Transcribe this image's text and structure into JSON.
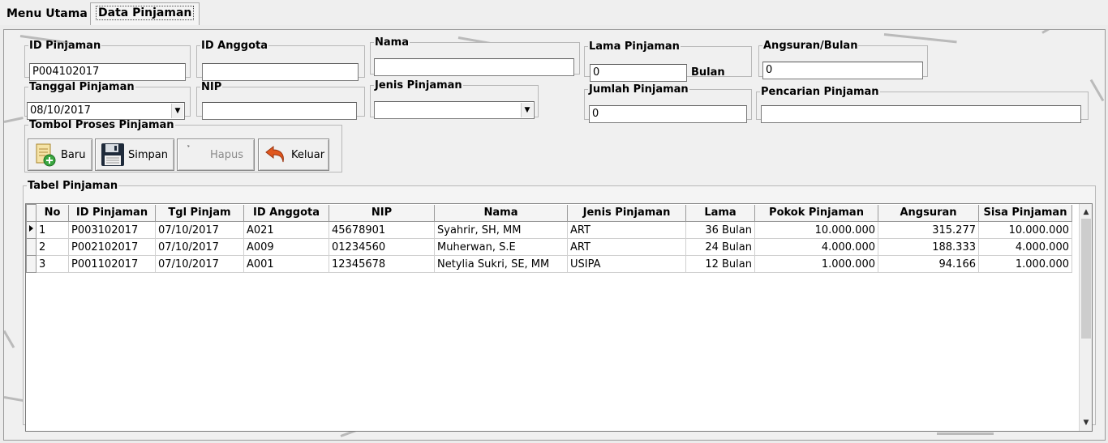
{
  "tabs": [
    {
      "label": "Menu Utama"
    },
    {
      "label": "Data Pinjaman"
    }
  ],
  "form": {
    "id_pinjaman": {
      "label": "ID Pinjaman",
      "value": "P004102017"
    },
    "id_anggota": {
      "label": "ID Anggota",
      "value": ""
    },
    "nama": {
      "label": "Nama",
      "value": ""
    },
    "lama_pinjaman": {
      "label": "Lama Pinjaman",
      "value": "0",
      "unit": "Bulan"
    },
    "angsuran_bulan": {
      "label": "Angsuran/Bulan",
      "value": "0"
    },
    "tanggal_pinjaman": {
      "label": "Tanggal Pinjaman",
      "value": "08/10/2017"
    },
    "nip": {
      "label": "NIP",
      "value": ""
    },
    "jenis_pinjaman": {
      "label": "Jenis Pinjaman",
      "value": ""
    },
    "jumlah_pinjaman": {
      "label": "Jumlah Pinjaman",
      "value": "0"
    },
    "pencarian_pinjaman": {
      "label": "Pencarian Pinjaman",
      "value": ""
    }
  },
  "buttons": {
    "group_label": "Tombol Proses Pinjaman",
    "baru": "Baru",
    "simpan": "Simpan",
    "hapus": "Hapus",
    "keluar": "Keluar"
  },
  "table": {
    "label": "Tabel Pinjaman",
    "columns": [
      "No",
      "ID Pinjaman",
      "Tgl Pinjam",
      "ID Anggota",
      "NIP",
      "Nama",
      "Jenis Pinjaman",
      "Lama",
      "Pokok Pinjaman",
      "Angsuran",
      "Sisa Pinjaman"
    ],
    "rows": [
      [
        "1",
        "P003102017",
        "07/10/2017",
        "A021",
        "45678901",
        "Syahrir, SH, MM",
        "ART",
        "36 Bulan",
        "10.000.000",
        "315.277",
        "10.000.000"
      ],
      [
        "2",
        "P002102017",
        "07/10/2017",
        "A009",
        "01234560",
        "Muherwan, S.E",
        "ART",
        "24 Bulan",
        "4.000.000",
        "188.333",
        "4.000.000"
      ],
      [
        "3",
        "P001102017",
        "07/10/2017",
        "A001",
        "12345678",
        "Netylia Sukri, SE, MM",
        "USIPA",
        "12 Bulan",
        "1.000.000",
        "94.166",
        "1.000.000"
      ]
    ]
  },
  "icons": {
    "baru": "new-document-icon",
    "simpan": "floppy-disk-icon",
    "hapus": "delete-icon",
    "keluar": "exit-arrow-icon",
    "current_row": "row-pointer-icon"
  },
  "colors": {
    "background": "#ececec",
    "panel": "#f0f0f0",
    "keluar_icon": "#e0571e"
  }
}
